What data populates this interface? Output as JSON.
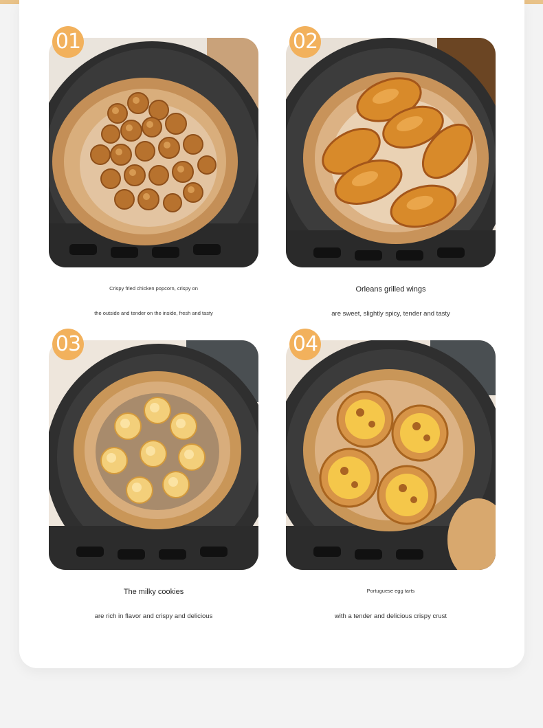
{
  "colors": {
    "accent": "#f2b15c",
    "paper": "#d9a46b",
    "fryer": "#2b2b2b"
  },
  "items": [
    {
      "number": "01",
      "title": "Crispy fried chicken popcorn, crispy on",
      "subtitle": "the outside and tender on the inside, fresh and tasty",
      "food": "popcorn chicken"
    },
    {
      "number": "02",
      "title": "Orleans grilled wings",
      "subtitle": "are sweet, slightly spicy, tender and tasty",
      "food": "grilled chicken wings"
    },
    {
      "number": "03",
      "title": "The milky cookies",
      "subtitle": "are rich in flavor and crispy and delicious",
      "food": "piped butter cookies"
    },
    {
      "number": "04",
      "title": "Portuguese egg tarts",
      "subtitle": "with a tender and delicious crispy crust",
      "food": "egg tarts"
    }
  ]
}
